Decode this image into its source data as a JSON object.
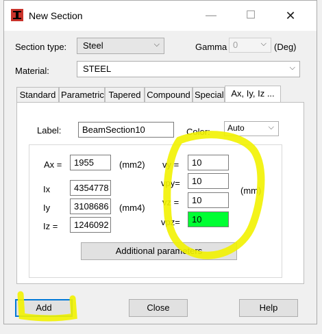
{
  "window": {
    "title": "New Section",
    "minimize_glyph": "—",
    "maximize_glyph": "☐",
    "close_glyph": "✕"
  },
  "top": {
    "section_type_label": "Section type:",
    "section_type_value": "Steel",
    "gamma_label": "Gamma",
    "gamma_value": "0",
    "gamma_unit": "(Deg)",
    "material_label": "Material:",
    "material_value": "STEEL",
    "dropdown_glyph": "⌵"
  },
  "tabs": [
    "Standard",
    "Parametric",
    "Tapered",
    "Compound",
    "Special",
    "Ax, Iy, Iz ..."
  ],
  "panel": {
    "label_caption": "Label:",
    "label_value": "BeamSection10",
    "color_caption": "Color:",
    "color_value": "Auto",
    "ax_label": "Ax =",
    "ax_value": "1955",
    "ax_unit": "(mm2)",
    "ix_label": "Ix",
    "ix_value": "4354778",
    "iy_label": "Iy",
    "iy_value": "3108686",
    "iz_label": "Iz =",
    "iz_value": "1246092",
    "i_unit": "(mm4)",
    "vy_label": "vy =",
    "vy_value": "10",
    "vpy_label": "vpy=",
    "vpy_value": "10",
    "vz_label": "vz =",
    "vz_value": "10",
    "vpz_label": "vpz=",
    "vpz_value": "10",
    "v_unit": "(mm)",
    "additional_button": "Additional parameters"
  },
  "buttons": {
    "add": "Add",
    "close": "Close",
    "help": "Help"
  },
  "colors": {
    "highlight": "#f2f200",
    "vpz_field": "#00ff33",
    "focus_border": "#0078d7",
    "icon_red": "#c8322a"
  }
}
